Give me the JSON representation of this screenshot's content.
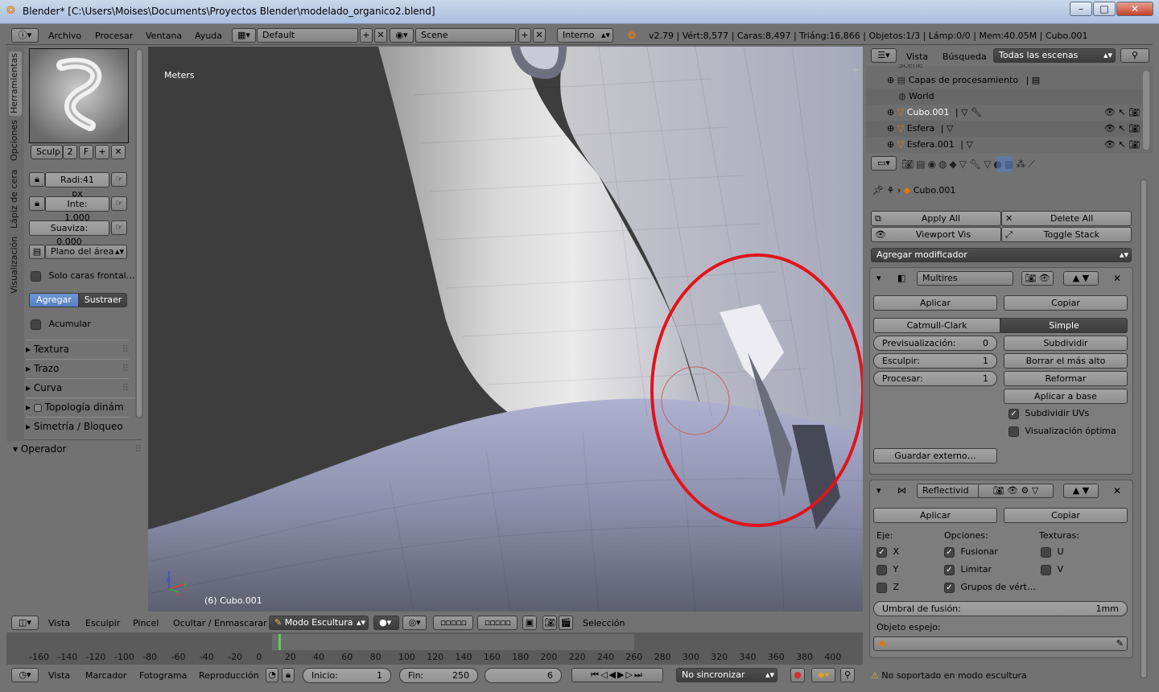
{
  "window": {
    "title": "Blender* [C:\\Users\\Moises\\Documents\\Proyectos Blender\\modelado_organico2.blend]",
    "minimize": "–",
    "maximize": "□",
    "close": "✕"
  },
  "infobar": {
    "menus": [
      "Archivo",
      "Procesar",
      "Ventana",
      "Ayuda"
    ],
    "layout": "Default",
    "scene": "Scene",
    "engine": "Interno",
    "stats": "v2.79 | Vért:8,577 | Caras:8,497 | Triáng:16,866 | Objetos:1/3 | Lámp:0/0 | Mem:40.05M | Cubo.001"
  },
  "toolshelf": {
    "tabs": [
      "Herramientas",
      "Opciones",
      "Lápiz de cera",
      "Visualización"
    ],
    "brush_name": "Sculp",
    "brush_users": "2",
    "brush_fake": "F",
    "radius": "Radi:41 px",
    "strength": "Inte: 1.000",
    "autosmooth": "Suaviza: 0.000",
    "sculpt_plane": "Plano del área",
    "front_faces": "Solo caras frontal…",
    "add": "Agregar",
    "subtract": "Sustraer",
    "accumulate": "Acumular",
    "panels": [
      "Textura",
      "Trazo",
      "Curva",
      "Topología dinám",
      "Simetría / Bloqueo"
    ],
    "operator": "Operador"
  },
  "viewport": {
    "units": "Meters",
    "object_label": "(6) Cubo.001",
    "axis_x": "x",
    "axis_y": "y",
    "axis_z": "z"
  },
  "vpheader": {
    "menus": [
      "Vista",
      "Esculpir",
      "Pincel",
      "Ocultar / Enmascarar"
    ],
    "mode": "Modo Escultura",
    "selection": "Selección"
  },
  "timeline": {
    "ticks": [
      "-160",
      "-140",
      "-120",
      "-100",
      "-80",
      "-60",
      "-40",
      "-20",
      "0",
      "20",
      "40",
      "60",
      "80",
      "100",
      "120",
      "140",
      "160",
      "180",
      "200",
      "220",
      "240",
      "260",
      "280",
      "300",
      "320",
      "340",
      "360",
      "380",
      "400"
    ],
    "menus": [
      "Vista",
      "Marcador",
      "Fotograma",
      "Reproducción"
    ],
    "start_label": "Inicio:",
    "start": "1",
    "end_label": "Fin:",
    "end": "250",
    "current": "6",
    "sync": "No sincronizar"
  },
  "outliner": {
    "menus": [
      "Vista",
      "Búsqueda"
    ],
    "filter": "Todas las escenas",
    "items": [
      "Scene",
      "Capas de procesamiento",
      "World",
      "Cubo.001",
      "Esfera",
      "Esfera.001"
    ]
  },
  "props": {
    "context_object": "Cubo.001",
    "apply_all": "Apply All",
    "delete_all": "Delete All",
    "viewport_vis": "Viewport Vis",
    "toggle_stack": "Toggle Stack",
    "add_modifier": "Agregar modificador",
    "multires": {
      "name": "Multires",
      "apply": "Aplicar",
      "copy": "Copiar",
      "catmull": "Catmull-Clark",
      "simple": "Simple",
      "preview_label": "Previsualización:",
      "preview": "0",
      "sculpt_label": "Esculpir:",
      "sculpt": "1",
      "render_label": "Procesar:",
      "render": "1",
      "subdivide": "Subdividir",
      "delete_higher": "Borrar el más alto",
      "reshape": "Reformar",
      "apply_base": "Aplicar a base",
      "subdiv_uvs": "Subdividir UVs",
      "optimal": "Visualización óptima",
      "save_external": "Guardar externo…"
    },
    "mirror": {
      "name": "Reflectivid",
      "apply": "Aplicar",
      "copy": "Copiar",
      "axis_label": "Eje:",
      "options_label": "Opciones:",
      "textures_label": "Texturas:",
      "x": "X",
      "y": "Y",
      "z": "Z",
      "merge": "Fusionar",
      "clipping": "Limitar",
      "vgroups": "Grupos de vért…",
      "u": "U",
      "v": "V",
      "merge_limit_label": "Umbral de fusión:",
      "merge_limit": "1mm",
      "mirror_object": "Objeto espejo:"
    },
    "warning": "No soportado en modo escultura"
  },
  "colors": {
    "accent_blue": "#5680c2",
    "annotation_red": "#e0141c",
    "mesh_light": "#d8d8da",
    "mesh_blue": "#9ea3c4"
  }
}
